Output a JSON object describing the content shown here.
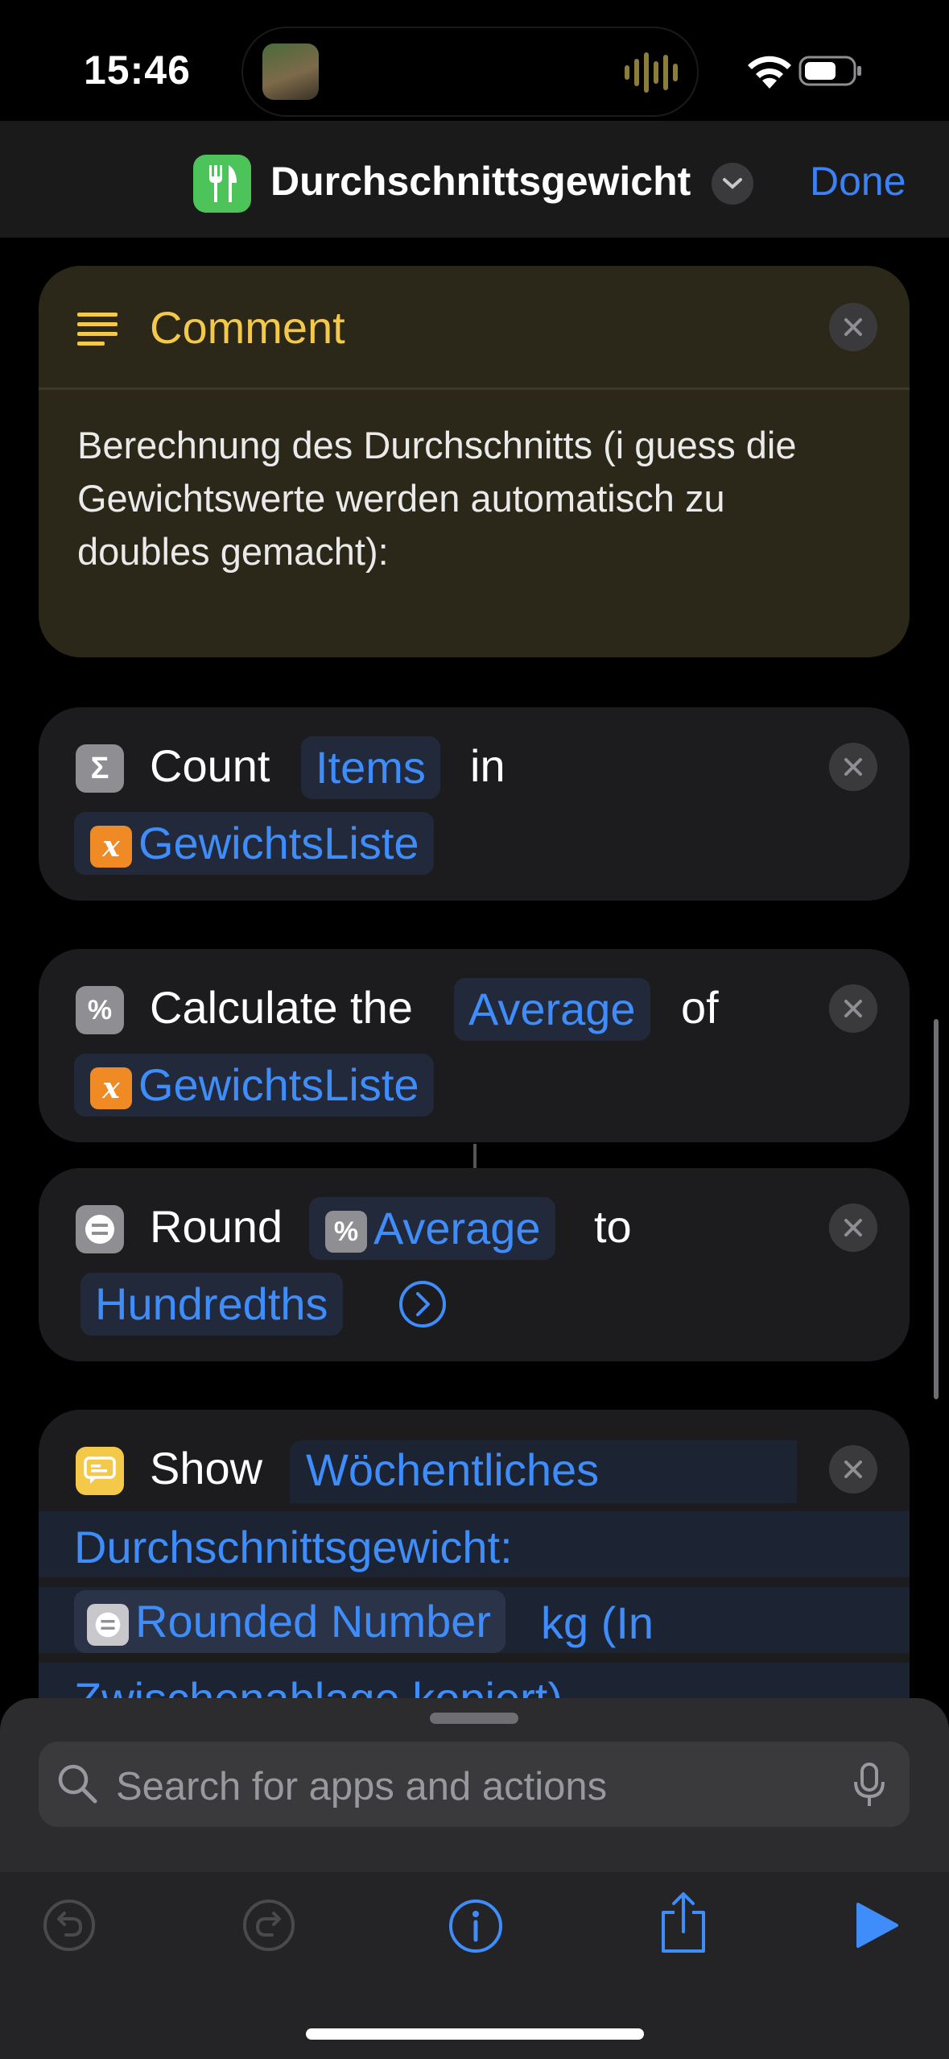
{
  "status": {
    "time": "15:46"
  },
  "nav": {
    "title": "Durchschnittsgewicht",
    "done_label": "Done"
  },
  "comment": {
    "title": "Comment",
    "lines": [
      "Berechnung des Durchschnitts (i guess die",
      "Gewichtswerte werden automatisch zu",
      "doubles gemacht):"
    ]
  },
  "count_action": {
    "label": "Count",
    "token": "Items",
    "connector": "in",
    "variable": "GewichtsListe"
  },
  "calc_action": {
    "label": "Calculate the",
    "token": "Average",
    "connector": "of",
    "variable": "GewichtsListe"
  },
  "round_action": {
    "label": "Round",
    "token": "Average",
    "connector": "to",
    "precision": "Hundredths"
  },
  "show_action": {
    "label": "Show",
    "line1": "Wöchentliches",
    "line2": "Durchschnittsgewicht:",
    "variable": "Rounded Number",
    "line3_suffix": "kg (In",
    "line4": "Zwischenablage kopiert)"
  },
  "search": {
    "placeholder": "Search for apps and actions"
  },
  "colors": {
    "accent": "#3e8dfa",
    "comment": "#f4c94a",
    "variable": "#f08a24",
    "app_icon": "#4cc459"
  },
  "icons": [
    "fork-knife-icon",
    "chevron-down-icon",
    "lines-icon",
    "sigma-icon",
    "percent-icon",
    "round-icon",
    "quote-bubble-icon",
    "close-icon",
    "search-icon",
    "mic-icon",
    "undo-icon",
    "redo-icon",
    "info-icon",
    "share-icon",
    "play-icon"
  ]
}
